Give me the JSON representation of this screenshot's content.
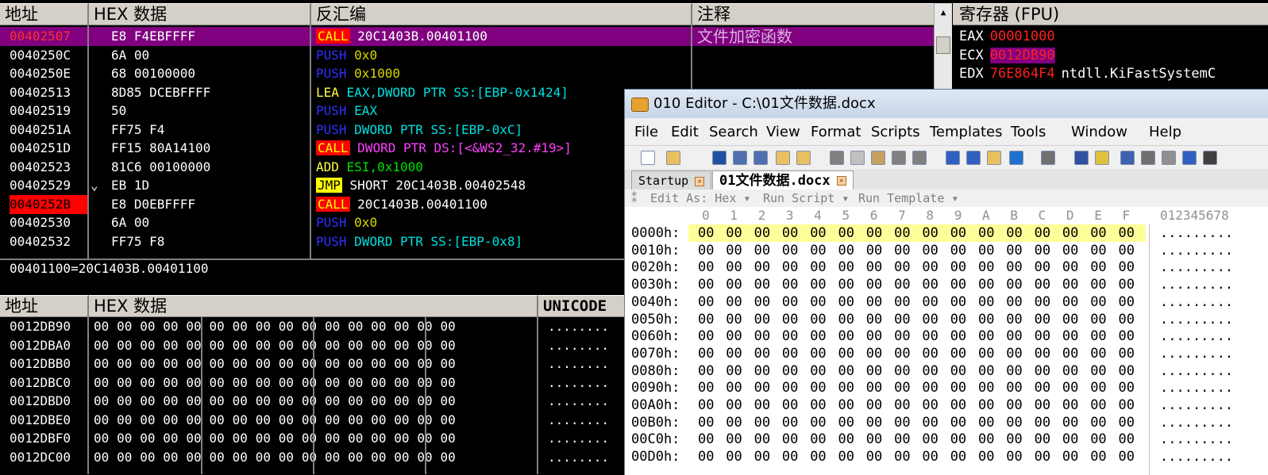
{
  "disasm": {
    "headers": {
      "addr": "地址",
      "hex": "HEX 数据",
      "dis": "反汇编",
      "comment": "注释"
    },
    "rows": [
      {
        "addr": "00402507",
        "hex": "E8 F4EBFFFF",
        "mnem": "CALL",
        "ops": "20C1403B.00401100",
        "comment": "文件加密函数",
        "selected": true
      },
      {
        "addr": "0040250C",
        "hex": "6A 00",
        "mnem": "PUSH",
        "ops": "0x0"
      },
      {
        "addr": "0040250E",
        "hex": "68 00100000",
        "mnem": "PUSH",
        "ops": "0x1000"
      },
      {
        "addr": "00402513",
        "hex": "8D85 DCEBFFFF",
        "mnem": "LEA",
        "ops": "EAX,DWORD PTR SS:[EBP-0x1424]"
      },
      {
        "addr": "00402519",
        "hex": "50",
        "mnem": "PUSH",
        "ops": "EAX"
      },
      {
        "addr": "0040251A",
        "hex": "FF75 F4",
        "mnem": "PUSH",
        "ops": "DWORD PTR SS:[EBP-0xC]"
      },
      {
        "addr": "0040251D",
        "hex": "FF15 80A14100",
        "mnem": "CALL",
        "ops": "DWORD PTR DS:[<&WS2_32.#19>]"
      },
      {
        "addr": "00402523",
        "hex": "81C6 00100000",
        "mnem": "ADD",
        "ops": "ESI,0x1000"
      },
      {
        "addr": "00402529",
        "hex": "EB 1D",
        "mnem": "JMP",
        "ops": "SHORT 20C1403B.00402548",
        "marker": "⌄"
      },
      {
        "addr": "0040252B",
        "hex": "E8 D0EBFFFF",
        "mnem": "CALL",
        "ops": "20C1403B.00401100",
        "addr_highlight": true
      },
      {
        "addr": "00402530",
        "hex": "6A 00",
        "mnem": "PUSH",
        "ops": "0x0"
      },
      {
        "addr": "00402532",
        "hex": "FF75 F8",
        "mnem": "PUSH",
        "ops": "DWORD PTR SS:[EBP-0x8]"
      }
    ],
    "info_line": "00401100=20C1403B.00401100"
  },
  "registers": {
    "header": "寄存器 (FPU)",
    "rows": [
      {
        "name": "EAX",
        "value": "00001000",
        "extra": ""
      },
      {
        "name": "ECX",
        "value": "0012DB90",
        "extra": "",
        "highlight": true
      },
      {
        "name": "EDX",
        "value": "76E864F4",
        "extra": "ntdll.KiFastSystemC"
      }
    ]
  },
  "dump": {
    "headers": {
      "addr": "地址",
      "hex": "HEX 数据",
      "unicode": "UNICODE"
    },
    "rows": [
      {
        "addr": "0012DB90",
        "bytes": "00 00 00 00 00 00 00 00 00 00 00 00 00 00 00 00",
        "text": "........"
      },
      {
        "addr": "0012DBA0",
        "bytes": "00 00 00 00 00 00 00 00 00 00 00 00 00 00 00 00",
        "text": "........"
      },
      {
        "addr": "0012DBB0",
        "bytes": "00 00 00 00 00 00 00 00 00 00 00 00 00 00 00 00",
        "text": "........"
      },
      {
        "addr": "0012DBC0",
        "bytes": "00 00 00 00 00 00 00 00 00 00 00 00 00 00 00 00",
        "text": "........"
      },
      {
        "addr": "0012DBD0",
        "bytes": "00 00 00 00 00 00 00 00 00 00 00 00 00 00 00 00",
        "text": "........"
      },
      {
        "addr": "0012DBE0",
        "bytes": "00 00 00 00 00 00 00 00 00 00 00 00 00 00 00 00",
        "text": "........"
      },
      {
        "addr": "0012DBF0",
        "bytes": "00 00 00 00 00 00 00 00 00 00 00 00 00 00 00 00",
        "text": "........"
      },
      {
        "addr": "0012DC00",
        "bytes": "00 00 00 00 00 00 00 00 00 00 00 00 00 00 00 00",
        "text": "........"
      }
    ]
  },
  "editor": {
    "title": "010 Editor - C:\\01文件数据.docx",
    "menu": [
      "File",
      "Edit",
      "Search",
      "View",
      "Format",
      "Scripts",
      "Templates",
      "Tools",
      "Window",
      "Help"
    ],
    "tabs": [
      "Startup",
      "01文件数据.docx"
    ],
    "subbar": [
      "Edit As: Hex ▾",
      "Run Script ▾",
      "Run Template ▾"
    ],
    "col_headers": [
      "0",
      "1",
      "2",
      "3",
      "4",
      "5",
      "6",
      "7",
      "8",
      "9",
      "A",
      "B",
      "C",
      "D",
      "E",
      "F"
    ],
    "ascii_header": "012345678",
    "hex_rows": [
      {
        "offset": "0000h:",
        "bytes": "00 00 00 00 00 00 00 00 00 00 00 00 00 00 00 00",
        "ascii": "........."
      },
      {
        "offset": "0010h:",
        "bytes": "00 00 00 00 00 00 00 00 00 00 00 00 00 00 00 00",
        "ascii": "........."
      },
      {
        "offset": "0020h:",
        "bytes": "00 00 00 00 00 00 00 00 00 00 00 00 00 00 00 00",
        "ascii": "........."
      },
      {
        "offset": "0030h:",
        "bytes": "00 00 00 00 00 00 00 00 00 00 00 00 00 00 00 00",
        "ascii": "........."
      },
      {
        "offset": "0040h:",
        "bytes": "00 00 00 00 00 00 00 00 00 00 00 00 00 00 00 00",
        "ascii": "........."
      },
      {
        "offset": "0050h:",
        "bytes": "00 00 00 00 00 00 00 00 00 00 00 00 00 00 00 00",
        "ascii": "........."
      },
      {
        "offset": "0060h:",
        "bytes": "00 00 00 00 00 00 00 00 00 00 00 00 00 00 00 00",
        "ascii": "........."
      },
      {
        "offset": "0070h:",
        "bytes": "00 00 00 00 00 00 00 00 00 00 00 00 00 00 00 00",
        "ascii": "........."
      },
      {
        "offset": "0080h:",
        "bytes": "00 00 00 00 00 00 00 00 00 00 00 00 00 00 00 00",
        "ascii": "........."
      },
      {
        "offset": "0090h:",
        "bytes": "00 00 00 00 00 00 00 00 00 00 00 00 00 00 00 00",
        "ascii": "........."
      },
      {
        "offset": "00A0h:",
        "bytes": "00 00 00 00 00 00 00 00 00 00 00 00 00 00 00 00",
        "ascii": "........."
      },
      {
        "offset": "00B0h:",
        "bytes": "00 00 00 00 00 00 00 00 00 00 00 00 00 00 00 00",
        "ascii": "........."
      },
      {
        "offset": "00C0h:",
        "bytes": "00 00 00 00 00 00 00 00 00 00 00 00 00 00 00 00",
        "ascii": "........."
      },
      {
        "offset": "00D0h:",
        "bytes": "00 00 00 00 00 00 00 00 00 00 00 00 00 00 00 00",
        "ascii": "........."
      }
    ]
  },
  "colors": {
    "selection": "#800080",
    "call_bg": "#ff0000",
    "push_fg": "#3030ff",
    "reg_value": "#ff2020",
    "hex_first_row": "#ffff99"
  }
}
